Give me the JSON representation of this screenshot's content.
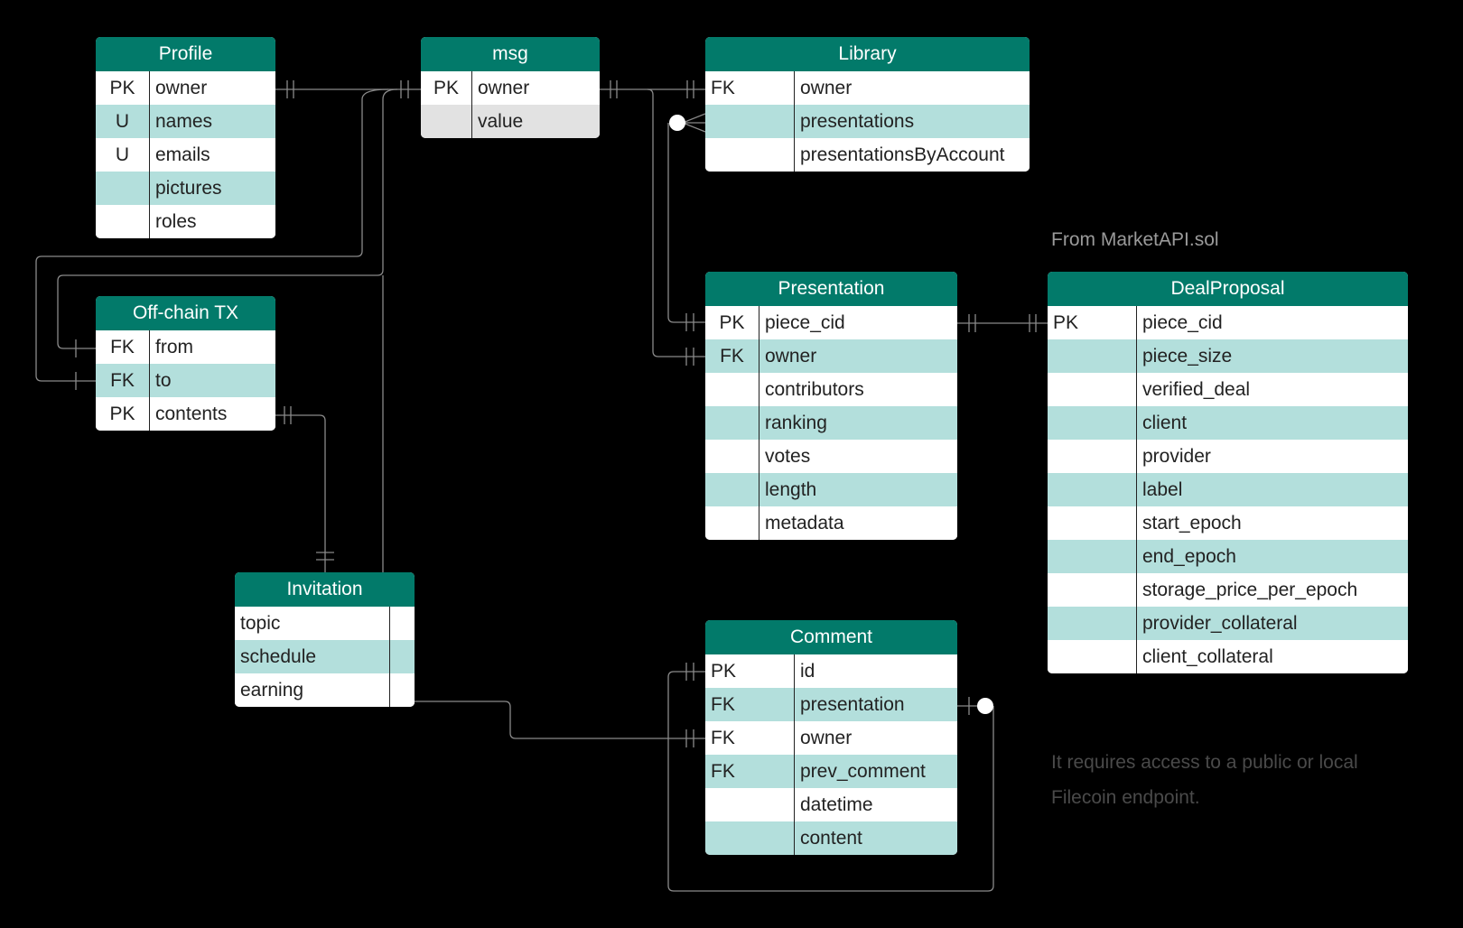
{
  "tables": [
    {
      "id": "profile",
      "title": "Profile",
      "rows": [
        [
          "PK",
          "owner"
        ],
        [
          "U",
          "names"
        ],
        [
          "U",
          "emails"
        ],
        [
          "",
          "pictures"
        ],
        [
          "",
          "roles"
        ]
      ]
    },
    {
      "id": "msg",
      "title": "msg",
      "rows": [
        [
          "PK",
          "owner"
        ],
        [
          "",
          "value"
        ]
      ]
    },
    {
      "id": "library",
      "title": "Library",
      "rows": [
        [
          "FK",
          "owner"
        ],
        [
          "",
          "presentations"
        ],
        [
          "",
          "presentationsByAccount"
        ]
      ]
    },
    {
      "id": "offchain",
      "title": "Off-chain TX",
      "rows": [
        [
          "FK",
          "from"
        ],
        [
          "FK",
          "to"
        ],
        [
          "PK",
          "contents"
        ]
      ]
    },
    {
      "id": "presentation",
      "title": "Presentation",
      "rows": [
        [
          "PK",
          "piece_cid"
        ],
        [
          "FK",
          "owner"
        ],
        [
          "",
          "contributors"
        ],
        [
          "",
          "ranking"
        ],
        [
          "",
          "votes"
        ],
        [
          "",
          "length"
        ],
        [
          "",
          "metadata"
        ]
      ]
    },
    {
      "id": "dealproposal",
      "title": "DealProposal",
      "rows": [
        [
          "PK",
          "piece_cid"
        ],
        [
          "",
          "piece_size"
        ],
        [
          "",
          "verified_deal"
        ],
        [
          "",
          "client"
        ],
        [
          "",
          "provider"
        ],
        [
          "",
          "label"
        ],
        [
          "",
          "start_epoch"
        ],
        [
          "",
          "end_epoch"
        ],
        [
          "",
          "storage_price_per_epoch"
        ],
        [
          "",
          "provider_collateral"
        ],
        [
          "",
          "client_collateral"
        ]
      ]
    },
    {
      "id": "invitation",
      "title": "Invitation",
      "rows": [
        [
          "",
          "topic"
        ],
        [
          "",
          "schedule"
        ],
        [
          "",
          "earning"
        ]
      ]
    },
    {
      "id": "comment",
      "title": "Comment",
      "rows": [
        [
          "PK",
          "id"
        ],
        [
          "FK",
          "presentation"
        ],
        [
          "FK",
          "owner"
        ],
        [
          "FK",
          "prev_comment"
        ],
        [
          "",
          "datetime"
        ],
        [
          "",
          "content"
        ]
      ]
    }
  ],
  "notes": {
    "source": "From MarketAPI.sol",
    "requirement_line1": "It requires access to a public or local",
    "requirement_line2": "Filecoin endpoint."
  },
  "colors": {
    "header": "#027a6a",
    "row_alt": "#b3dfdc",
    "line": "#8a8a8a"
  }
}
